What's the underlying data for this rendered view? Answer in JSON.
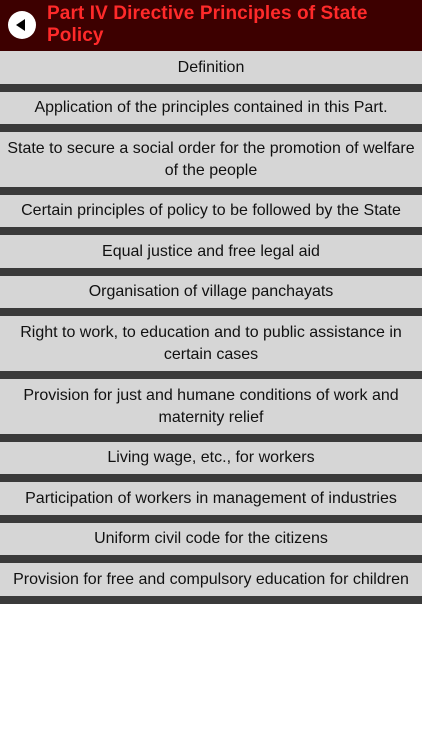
{
  "header": {
    "title": "Part IV Directive Principles of State Policy",
    "back_icon": "back-arrow-icon",
    "background_color": "#3d0000",
    "title_color": "#ff2a2a"
  },
  "list": {
    "items": [
      {
        "label": "Definition"
      },
      {
        "label": "Application of the principles contained in this Part."
      },
      {
        "label": "State to secure a social order for the promotion of welfare of the people"
      },
      {
        "label": "Certain principles of policy to be followed by the State"
      },
      {
        "label": "Equal justice and free legal aid"
      },
      {
        "label": "Organisation of village panchayats"
      },
      {
        "label": "Right to work, to education and to public assistance in certain cases"
      },
      {
        "label": "Provision for just and humane conditions of work and maternity relief"
      },
      {
        "label": "Living wage, etc., for workers"
      },
      {
        "label": "Participation of workers in management of industries"
      },
      {
        "label": "Uniform civil code for the citizens"
      },
      {
        "label": "Provision for free and compulsory education for children"
      }
    ],
    "item_color": "#d6d6d6",
    "separator_color": "#3a3a3a"
  }
}
